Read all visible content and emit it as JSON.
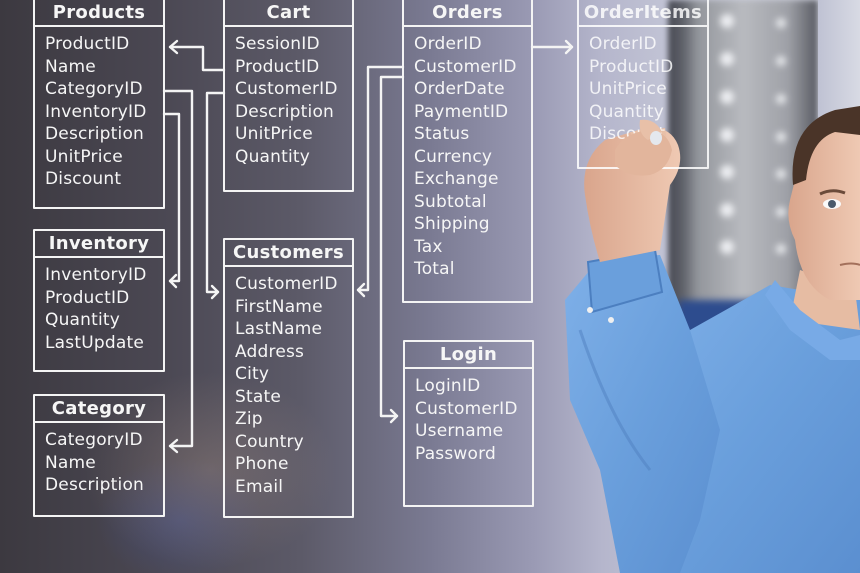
{
  "scene": {
    "description": "Man in blue shirt drawing a database schema diagram on a transparent board",
    "colors": {
      "chalk": "#f4f4f4",
      "board_dark": "#3c3940",
      "board_light": "#c6c8d8",
      "shirt": "#6fa3df",
      "skin": "#e3b9a0"
    }
  },
  "tables": [
    {
      "id": "products",
      "title": "Products",
      "fields": [
        "ProductID",
        "Name",
        "CategoryID",
        "InventoryID",
        "Description",
        "UnitPrice",
        "Discount"
      ]
    },
    {
      "id": "inventory",
      "title": "Inventory",
      "fields": [
        "InventoryID",
        "ProductID",
        "Quantity",
        "LastUpdate"
      ]
    },
    {
      "id": "category",
      "title": "Category",
      "fields": [
        "CategoryID",
        "Name",
        "Description"
      ]
    },
    {
      "id": "cart",
      "title": "Cart",
      "fields": [
        "SessionID",
        "ProductID",
        "CustomerID",
        "Description",
        "UnitPrice",
        "Quantity"
      ]
    },
    {
      "id": "customers",
      "title": "Customers",
      "fields": [
        "CustomerID",
        "FirstName",
        "LastName",
        "Address",
        "City",
        "State",
        "Zip",
        "Country",
        "Phone",
        "Email"
      ]
    },
    {
      "id": "orders",
      "title": "Orders",
      "fields": [
        "OrderID",
        "CustomerID",
        "OrderDate",
        "PaymentID",
        "Status",
        "Currency",
        "Exchange",
        "Subtotal",
        "Shipping",
        "Tax",
        "Total"
      ]
    },
    {
      "id": "login",
      "title": "Login",
      "fields": [
        "LoginID",
        "CustomerID",
        "Username",
        "Password"
      ]
    },
    {
      "id": "orderitems",
      "title": "OrderItems",
      "fields": [
        "OrderID",
        "ProductID",
        "UnitPrice",
        "Quantity",
        "Discount"
      ]
    }
  ],
  "relationships": [
    {
      "from": "Cart.ProductID",
      "to": "Products.ProductID"
    },
    {
      "from": "Products.InventoryID",
      "to": "Inventory.InventoryID"
    },
    {
      "from": "Products.CategoryID",
      "to": "Category.CategoryID"
    },
    {
      "from": "Cart.CustomerID",
      "to": "Customers.CustomerID"
    },
    {
      "from": "Orders.CustomerID",
      "to": "Customers.CustomerID"
    },
    {
      "from": "Orders.CustomerID",
      "to": "Login.CustomerID"
    },
    {
      "from": "Orders.OrderID",
      "to": "OrderItems.OrderID"
    }
  ]
}
